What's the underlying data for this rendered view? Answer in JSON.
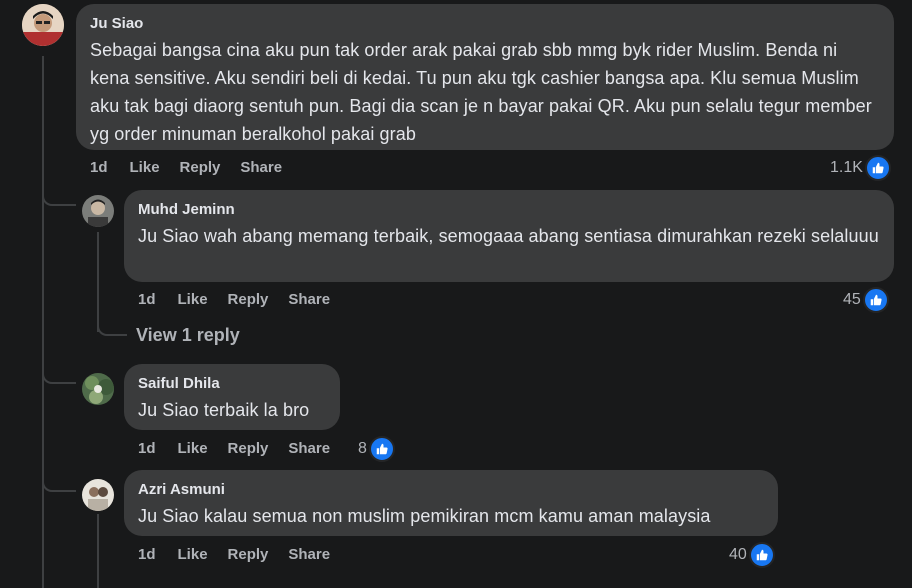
{
  "comments": [
    {
      "author": "Ju Siao",
      "text": "Sebagai bangsa cina aku pun tak order arak pakai grab sbb mmg byk rider Muslim. Benda ni kena sensitive. Aku sendiri beli di kedai. Tu pun aku tgk cashier bangsa apa. Klu semua Muslim aku tak bagi diaorg sentuh pun. Bagi dia scan je n bayar pakai QR. Aku pun selalu tegur member yg order minuman beralkohol pakai grab",
      "time": "1d",
      "like": "Like",
      "reply": "Reply",
      "share": "Share",
      "reactions": "1.1K"
    },
    {
      "author": "Muhd Jeminn",
      "text": "Ju Siao wah abang memang terbaik, semogaaa abang sentiasa dimurahkan rezeki selaluuu",
      "time": "1d",
      "like": "Like",
      "reply": "Reply",
      "share": "Share",
      "reactions": "45"
    },
    {
      "author": "Saiful Dhila",
      "text": "Ju Siao terbaik la bro",
      "time": "1d",
      "like": "Like",
      "reply": "Reply",
      "share": "Share",
      "reactions": "8"
    },
    {
      "author": "Azri Asmuni",
      "text": "Ju Siao kalau semua non muslim pemikiran mcm kamu aman malaysia",
      "time": "1d",
      "like": "Like",
      "reply": "Reply",
      "share": "Share",
      "reactions": "40"
    }
  ],
  "view_replies": "View 1 reply",
  "colors": {
    "bubble": "#3a3b3c",
    "background": "#18191a",
    "like_blue": "#1877f2"
  }
}
